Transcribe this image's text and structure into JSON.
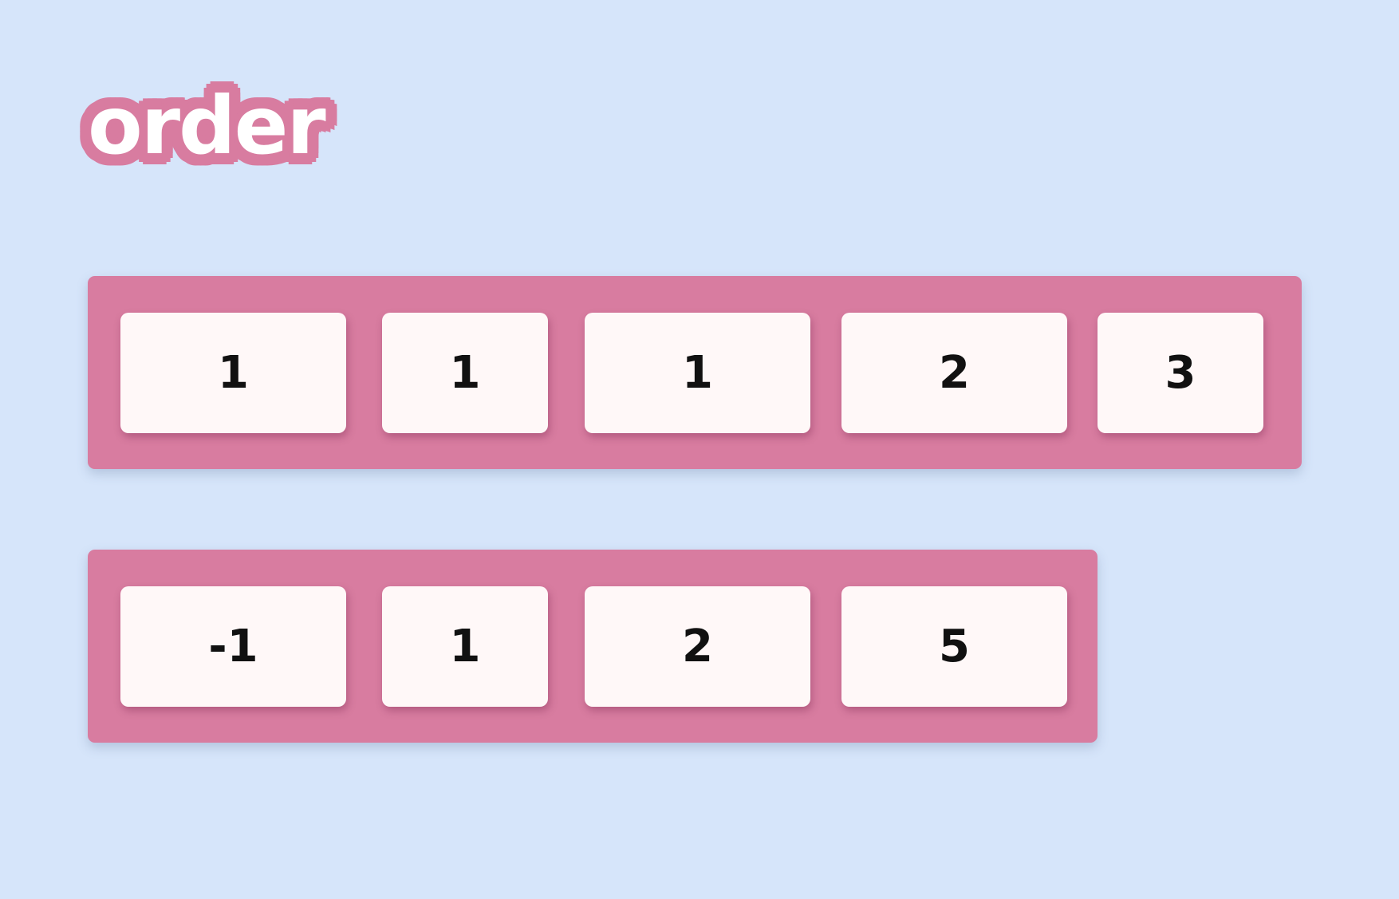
{
  "title": "order",
  "rows": [
    {
      "items": [
        "1",
        "1",
        "1",
        "2",
        "3"
      ]
    },
    {
      "items": [
        "-1",
        "1",
        "2",
        "5"
      ]
    }
  ],
  "colors": {
    "background": "#d6e5fa",
    "container": "#d87ca0",
    "card": "#fff8f8",
    "text": "#111111"
  }
}
